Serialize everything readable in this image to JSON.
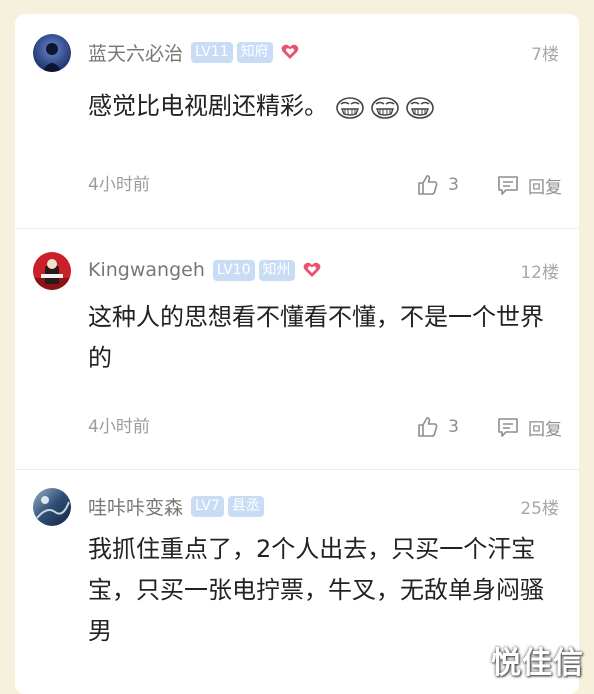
{
  "comments": [
    {
      "username": "蓝天六必治",
      "level": "LV11",
      "title": "知府",
      "heart": true,
      "floor": "7楼",
      "text": "感觉比电视剧还精彩。",
      "emoji_count": 3,
      "time": "4小时前",
      "likes": "3",
      "reply": "回复",
      "avatar": "blue-sky-avatar"
    },
    {
      "username": "Kingwangeh",
      "level": "LV10",
      "title": "知州",
      "heart": true,
      "floor": "12楼",
      "text": "这种人的思想看不懂看不懂，不是一个世界的",
      "time": "4小时前",
      "likes": "3",
      "reply": "回复",
      "avatar": "red-avatar"
    },
    {
      "username": "哇咔咔变森",
      "level": "LV7",
      "title": "县丞",
      "heart": false,
      "floor": "25楼",
      "text": "我抓住重点了，2个人出去，只买一个汗宝宝，只买一张电拧票，牛叉，无敌单身闷骚男",
      "avatar": "ocean-avatar"
    }
  ],
  "watermark": "悦佳信",
  "colors": {
    "page_bg": "#f6f1dc",
    "card_bg": "#ffffff",
    "badge_bg": "#c9dcf5",
    "heart": "#e8546f",
    "username": "#777777",
    "meta": "#9c9c9c"
  }
}
